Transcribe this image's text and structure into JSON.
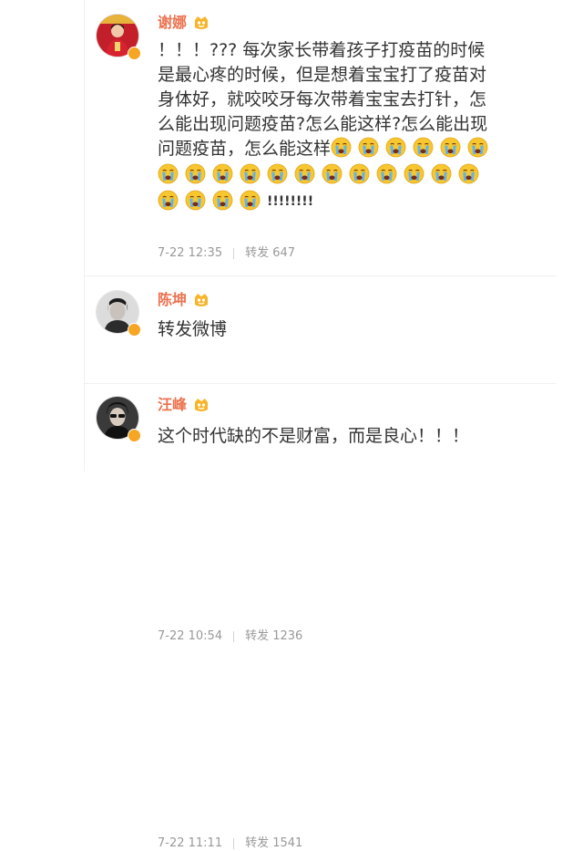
{
  "comments": [
    {
      "author": "谢娜",
      "text_lines": [
        "！！！??? 每次家长带着孩子打疫苗的时候",
        "是最心疼的时候，但是想着宝宝打了疫苗对",
        "身体好，就咬咬牙每次带着宝宝去打针，怎",
        "么能出现问题疫苗?怎么能这样?怎么能出现",
        "问题疫苗，怎么能这样"
      ],
      "trailing_exclamations": "!!!!!!!!",
      "emoji_name": "crying-face-emoji",
      "emoji_count": 22,
      "time": "7-22 12:35",
      "repost": "转发 647"
    },
    {
      "author": "陈坤",
      "text": "转发微博",
      "time": "7-22 10:54",
      "repost": "转发 1236"
    },
    {
      "author": "汪峰",
      "text": "这个时代缺的不是财富，而是良心！！！",
      "time": "7-22 11:11",
      "repost": "转发 1541"
    }
  ],
  "colors": {
    "name": "#eb7350",
    "text": "#333333",
    "meta": "#999999",
    "verified_badge": "#f5a623"
  }
}
